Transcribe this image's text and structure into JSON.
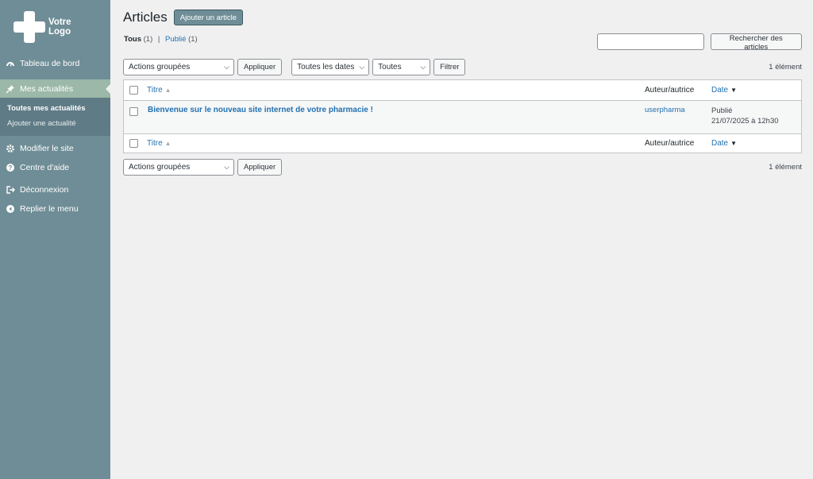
{
  "brand": {
    "logo_text": "Votre\nLogo",
    "accent": "#6f8d96"
  },
  "sidebar": {
    "items": [
      {
        "label": "Tableau de bord",
        "icon": "dashboard-icon"
      },
      {
        "label": "Mes actualités",
        "icon": "pin-icon",
        "active": true
      },
      {
        "label": "Modifier le site",
        "icon": "gear-icon"
      },
      {
        "label": "Centre d'aide",
        "icon": "help-icon"
      },
      {
        "label": "Déconnexion",
        "icon": "logout-icon"
      },
      {
        "label": "Replier le menu",
        "icon": "collapse-icon"
      }
    ],
    "submenu": [
      {
        "label": "Toutes mes actualités",
        "current": true
      },
      {
        "label": "Ajouter une actualité"
      }
    ]
  },
  "header": {
    "title": "Articles",
    "add_button": "Ajouter un article"
  },
  "filters": {
    "all_label": "Tous",
    "all_count": "(1)",
    "separator": "|",
    "published_label": "Publié",
    "published_count": "(1)"
  },
  "search": {
    "placeholder": "",
    "button": "Rechercher des articles"
  },
  "tablenav_top": {
    "bulk_actions": "Actions groupées",
    "apply": "Appliquer",
    "dates": "Toutes les dates",
    "categories": "Toutes",
    "filter": "Filtrer",
    "count": "1 élément"
  },
  "table": {
    "columns": {
      "title": "Titre",
      "author": "Auteur/autrice",
      "date": "Date"
    },
    "rows": [
      {
        "title": "Bienvenue sur le nouveau site internet de votre pharmacie !",
        "author": "userpharma",
        "status": "Publié",
        "date": "21/07/2025 à 12h30"
      }
    ]
  },
  "tablenav_bottom": {
    "bulk_actions": "Actions groupées",
    "apply": "Appliquer",
    "count": "1 élément"
  }
}
